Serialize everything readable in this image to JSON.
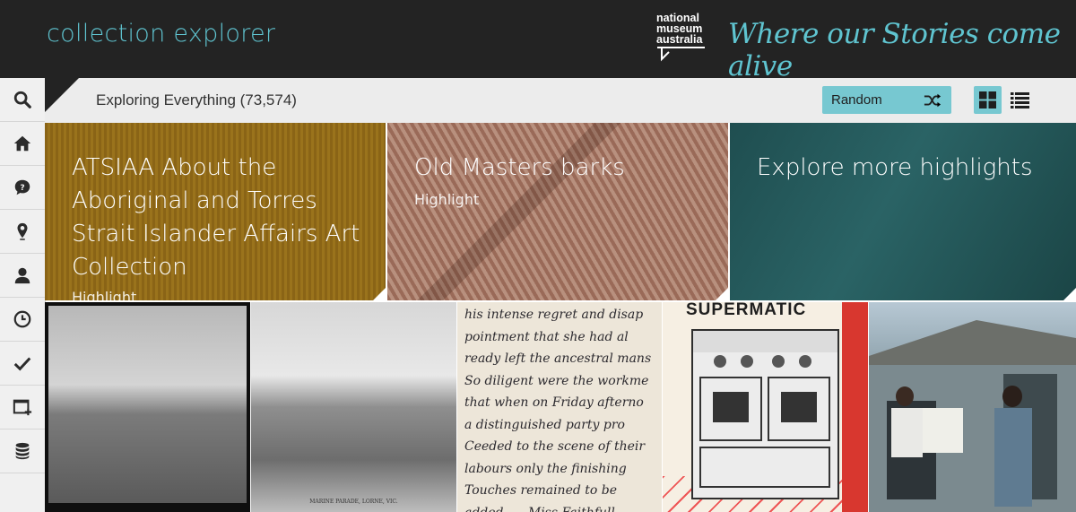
{
  "header": {
    "app_title": "collection explorer",
    "logo_text_1": "national",
    "logo_text_2": "museum",
    "logo_text_3": "australia",
    "tagline": "Where our Stories come alive"
  },
  "sidebar": {
    "items": [
      {
        "icon": "search-icon"
      },
      {
        "icon": "home-icon"
      },
      {
        "icon": "comment-question-icon"
      },
      {
        "icon": "map-pin-icon"
      },
      {
        "icon": "person-icon"
      },
      {
        "icon": "clock-icon"
      },
      {
        "icon": "checkmark-icon"
      },
      {
        "icon": "add-window-icon"
      },
      {
        "icon": "database-icon"
      }
    ]
  },
  "toolbar": {
    "explore_label": "Exploring Everything (73,574)",
    "sort_label": "Random",
    "sort_icon": "shuffle-icon",
    "grid_icon": "grid-view-icon",
    "list_icon": "list-view-icon",
    "accent": "#77c8d1"
  },
  "features": [
    {
      "title_lines": [
        "ATSIAA About the",
        "Aboriginal and Torres",
        "Strait Islander Affairs Art",
        "Collection"
      ],
      "subtitle": "Highlight"
    },
    {
      "title_lines": [
        "Old Masters barks"
      ],
      "subtitle": "Highlight"
    },
    {
      "title_lines": [
        "Explore more highlights"
      ],
      "subtitle": ""
    }
  ],
  "thumbnails": {
    "t2_caption": "MARINE PARADE, LORNE, VIC.",
    "t3_lines": [
      "his intense regret and disap",
      "pointment that she had al",
      "ready left the ancestral mans",
      "So diligent were the workme",
      "that when on Friday afterno",
      "a distinguished party pro",
      "Ceeded to the scene of their",
      "labours only the finishing",
      "Touches remained to be",
      "added. — Miss Faithfull,"
    ],
    "t4_brand": "SUPERMATIC"
  },
  "colors": {
    "header_bg": "#232323",
    "accent_teal": "#5fc4d0"
  }
}
